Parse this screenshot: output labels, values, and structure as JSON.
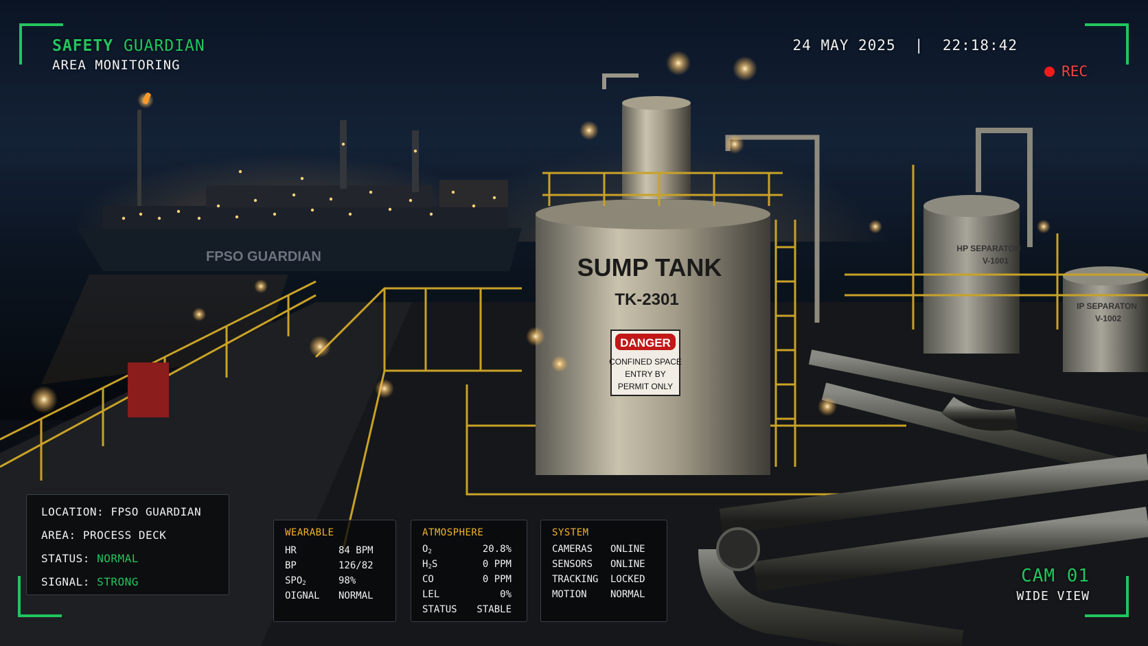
{
  "header": {
    "brand_word1": "SAFETY",
    "brand_word2": "GUARDIAN",
    "subtitle": "AREA MONITORING",
    "date": "24 MAY 2025",
    "time": "22:18:42",
    "rec_label": "REC"
  },
  "camera": {
    "id": "CAM 01",
    "view": "WIDE VIEW"
  },
  "scene_labels": {
    "ship_name": "FPSO GUARDIAN",
    "tank_name": "SUMP TANK",
    "tank_id": "TK-2301",
    "danger_title": "DANGER",
    "danger_line1": "CONFINED SPACE",
    "danger_line2": "ENTRY BY",
    "danger_line3": "PERMIT ONLY",
    "hp_sep_name": "HP SEPARATON",
    "hp_sep_id": "V-1001",
    "lp_sep_name": "IP SEPARATON",
    "lp_sep_id": "V-1002"
  },
  "location_panel": {
    "location_label": "LOCATION:",
    "location_value": "FPSO GUARDIAN",
    "area_label": "AREA:",
    "area_value": "PROCESS DECK",
    "status_label": "STATUS:",
    "status_value": "NORMAL",
    "signal_label": "SIGNAL:",
    "signal_value": "STRONG"
  },
  "wearable": {
    "title": "WEARABLE",
    "hr_label": "HR",
    "hr_value": "84 BPM",
    "bp_label": "BP",
    "bp_value": "126/82",
    "spo2_label": "SPO",
    "spo2_sub": "2",
    "spo2_value": "98%",
    "signal_label": "OIGNAL",
    "signal_value": "NORMAL"
  },
  "atmosphere": {
    "title": "ATMOSPHERE",
    "o2_label": "O",
    "o2_sub": "2",
    "o2_value": "20.8%",
    "h2s_label1": "H",
    "h2s_sub": "2",
    "h2s_label2": "S",
    "h2s_value": "0 PPM",
    "co_label": "CO",
    "co_value": "0 PPM",
    "lel_label": "LEL",
    "lel_value": "0%",
    "status_label": "STATUS",
    "status_value": "STABLE"
  },
  "system": {
    "title": "SYSTEM",
    "cameras_label": "CAMERAS",
    "cameras_value": "ONLINE",
    "sensors_label": "SENSORS",
    "sensors_value": "ONLINE",
    "tracking_label": "TRACKING",
    "tracking_value": "LOCKED",
    "motion_label": "MOTION",
    "motion_value": "NORMAL"
  },
  "colors": {
    "accent": "#22c55e",
    "warning": "#f5b32a",
    "rec": "#ef4444",
    "rail": "#c9a227"
  }
}
